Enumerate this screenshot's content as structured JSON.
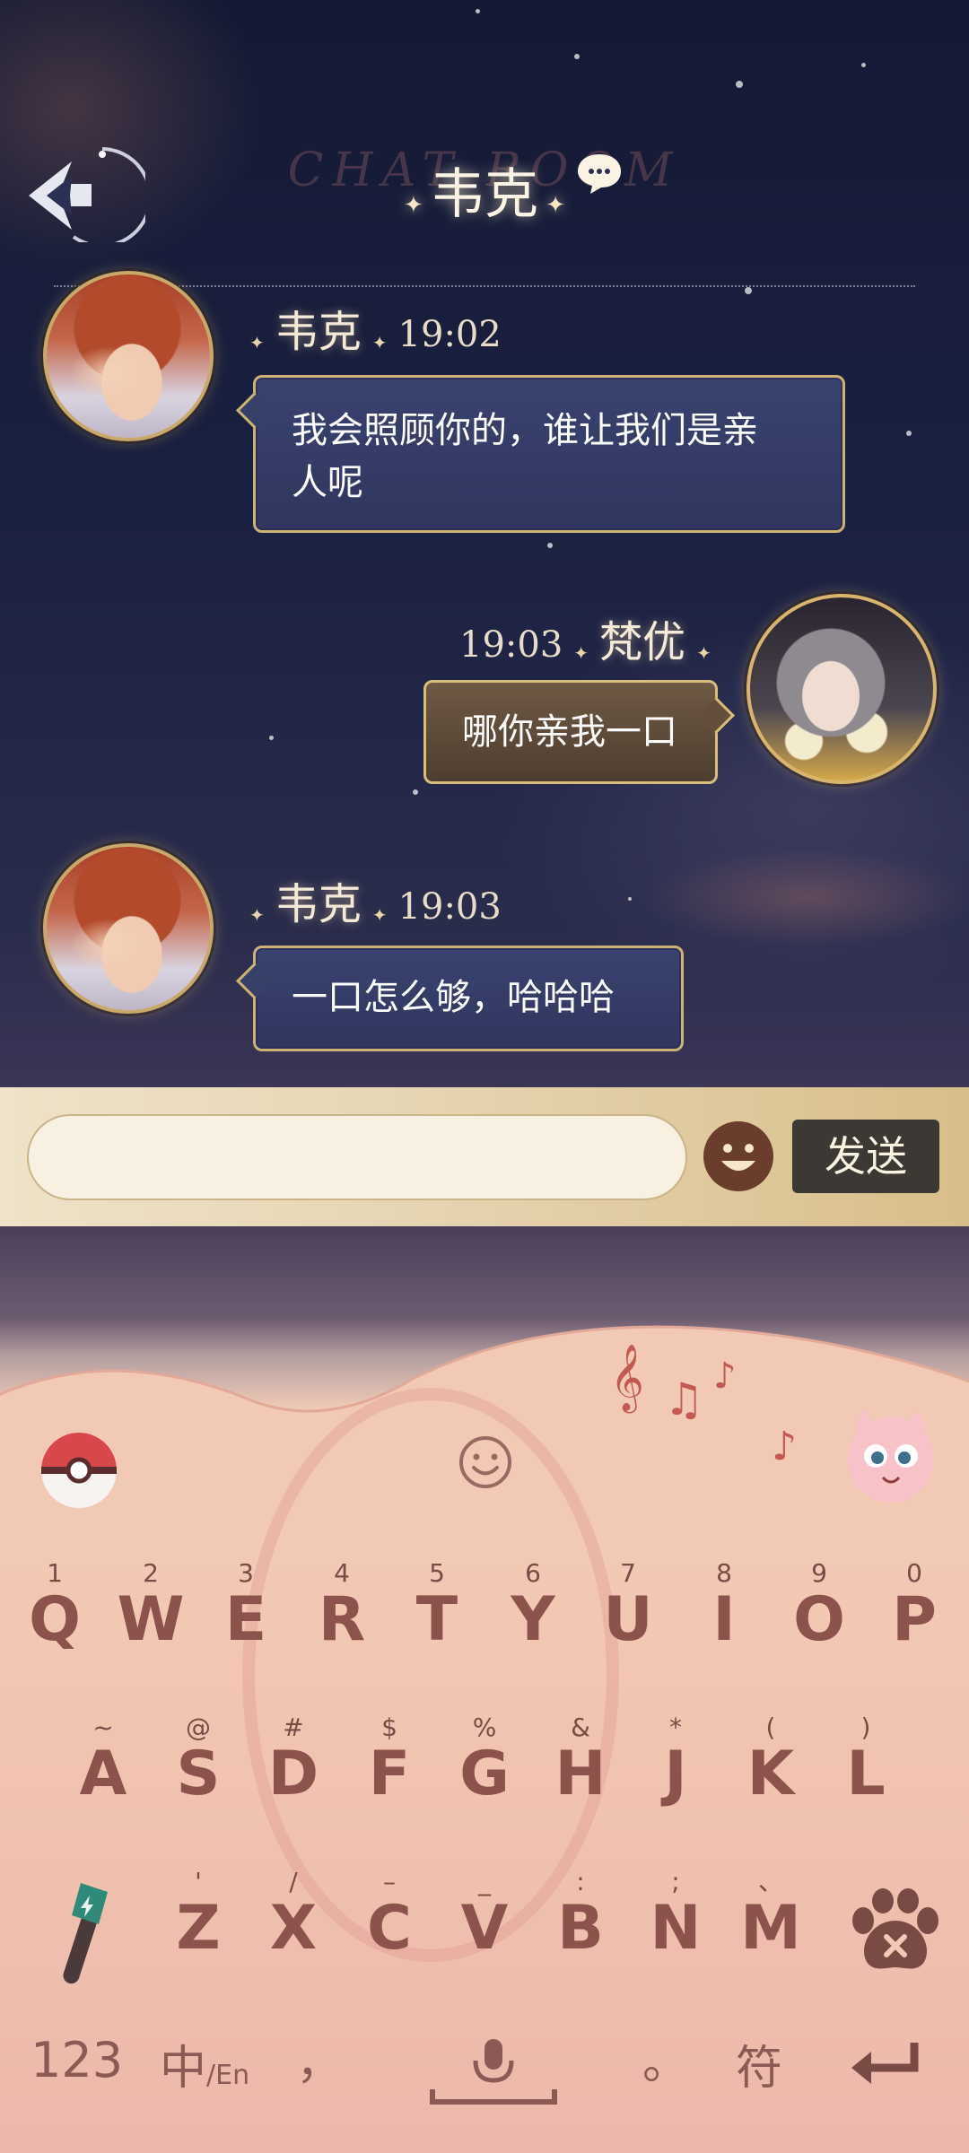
{
  "header": {
    "title": "韦克",
    "watermark": "CHAT ROOM"
  },
  "messages": [
    {
      "sender": "韦克",
      "time": "19:02",
      "text_line1": "我会照顾你的，谁让我们是亲",
      "text_line2": "人呢",
      "side": "left"
    },
    {
      "sender": "梵优",
      "time": "19:03",
      "text": "哪你亲我一口",
      "side": "right"
    },
    {
      "sender": "韦克",
      "time": "19:03",
      "text": "一口怎么够，哈哈哈",
      "side": "left"
    }
  ],
  "input_bar": {
    "placeholder": "",
    "value": "",
    "send_label": "发送"
  },
  "keyboard": {
    "row1": [
      {
        "main": "Q",
        "sub": "1"
      },
      {
        "main": "W",
        "sub": "2"
      },
      {
        "main": "E",
        "sub": "3"
      },
      {
        "main": "R",
        "sub": "4"
      },
      {
        "main": "T",
        "sub": "5"
      },
      {
        "main": "Y",
        "sub": "6"
      },
      {
        "main": "U",
        "sub": "7"
      },
      {
        "main": "I",
        "sub": "8"
      },
      {
        "main": "O",
        "sub": "9"
      },
      {
        "main": "P",
        "sub": "0"
      }
    ],
    "row2": [
      {
        "main": "A",
        "sub": "~"
      },
      {
        "main": "S",
        "sub": "@"
      },
      {
        "main": "D",
        "sub": "#"
      },
      {
        "main": "F",
        "sub": "$"
      },
      {
        "main": "G",
        "sub": "%"
      },
      {
        "main": "H",
        "sub": "&"
      },
      {
        "main": "J",
        "sub": "*"
      },
      {
        "main": "K",
        "sub": "("
      },
      {
        "main": "L",
        "sub": ")"
      }
    ],
    "row3": [
      {
        "main": "Z",
        "sub": "'"
      },
      {
        "main": "X",
        "sub": "/"
      },
      {
        "main": "C",
        "sub": "–"
      },
      {
        "main": "V",
        "sub": "_"
      },
      {
        "main": "B",
        "sub": ":"
      },
      {
        "main": "N",
        "sub": ";"
      },
      {
        "main": "M",
        "sub": "、"
      }
    ],
    "bottom": {
      "num_label": "123",
      "lang_main": "中",
      "lang_sub": "/En",
      "comma": "，",
      "period": "。",
      "symbol_label": "符"
    }
  },
  "colors": {
    "bubble_left": "#3a4270",
    "bubble_right": "#6f5a44",
    "gold_border": "#cdb273",
    "key_text": "#8c524c"
  },
  "icons": [
    "back-arrow-icon",
    "chat-bubble-icon",
    "emoji-icon",
    "pokeball-icon",
    "smiley-icon",
    "jigglypuff-icon",
    "music-notes-icon",
    "microphone-stick-icon",
    "paw-delete-icon",
    "voice-mic-icon",
    "enter-arrow-icon"
  ]
}
